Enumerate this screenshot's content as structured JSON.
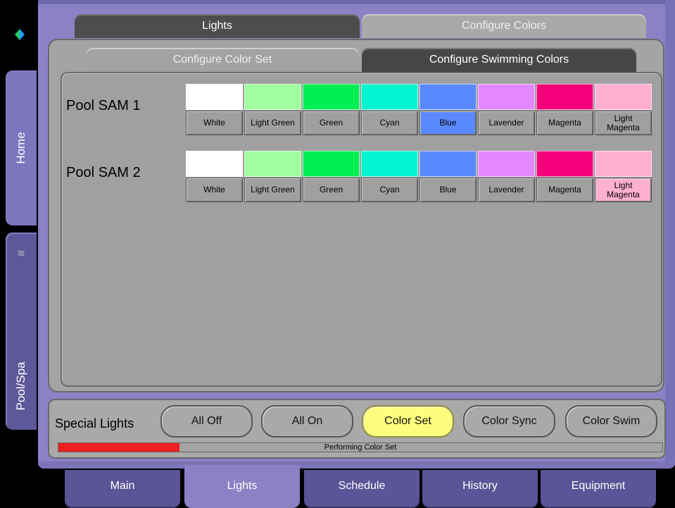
{
  "side_tabs": [
    {
      "label": "Home",
      "icon": "pool-waves-icon"
    },
    {
      "label": "Pool/Spa"
    }
  ],
  "top_tabs": [
    {
      "label": "Lights",
      "active": false
    },
    {
      "label": "Configure Colors",
      "active": true
    }
  ],
  "sub_tabs": [
    {
      "label": "Configure Color Set",
      "active": true
    },
    {
      "label": "Configure Swimming Colors",
      "active": false
    }
  ],
  "pools": [
    {
      "label": "Pool SAM 1",
      "selected_color": "Blue",
      "colors": [
        {
          "name": "White",
          "hex": "#ffffff"
        },
        {
          "name": "Light Green",
          "hex": "#a0ffa0"
        },
        {
          "name": "Green",
          "hex": "#00ee55"
        },
        {
          "name": "Cyan",
          "hex": "#00f5d0"
        },
        {
          "name": "Blue",
          "hex": "#5a88ff"
        },
        {
          "name": "Lavender",
          "hex": "#e488ff"
        },
        {
          "name": "Magenta",
          "hex": "#f5007a"
        },
        {
          "name": "Light\nMagenta",
          "hex": "#ffb0d0"
        }
      ]
    },
    {
      "label": "Pool SAM 2",
      "selected_color": "Light Magenta",
      "colors": [
        {
          "name": "White",
          "hex": "#ffffff"
        },
        {
          "name": "Light Green",
          "hex": "#a0ffa0"
        },
        {
          "name": "Green",
          "hex": "#00ee55"
        },
        {
          "name": "Cyan",
          "hex": "#00f5d0"
        },
        {
          "name": "Blue",
          "hex": "#5a88ff"
        },
        {
          "name": "Lavender",
          "hex": "#e488ff"
        },
        {
          "name": "Magenta",
          "hex": "#f5007a"
        },
        {
          "name": "Light\nMagenta",
          "hex": "#ffb0d0"
        }
      ]
    }
  ],
  "special_lights": {
    "label": "Special Lights",
    "buttons": [
      {
        "label": "All Off"
      },
      {
        "label": "All On"
      },
      {
        "label": "Color Set",
        "active": true
      },
      {
        "label": "Color Sync"
      },
      {
        "label": "Color Swim"
      }
    ],
    "status_text": "Performing Color Set",
    "progress": 0.2,
    "progress_color": "#ee1f1f",
    "highlight_color": "#fdfd7e"
  },
  "bottom_tabs": [
    {
      "label": "Main"
    },
    {
      "label": "Lights",
      "active": true
    },
    {
      "label": "Schedule"
    },
    {
      "label": "History"
    },
    {
      "label": "Equipment"
    }
  ]
}
